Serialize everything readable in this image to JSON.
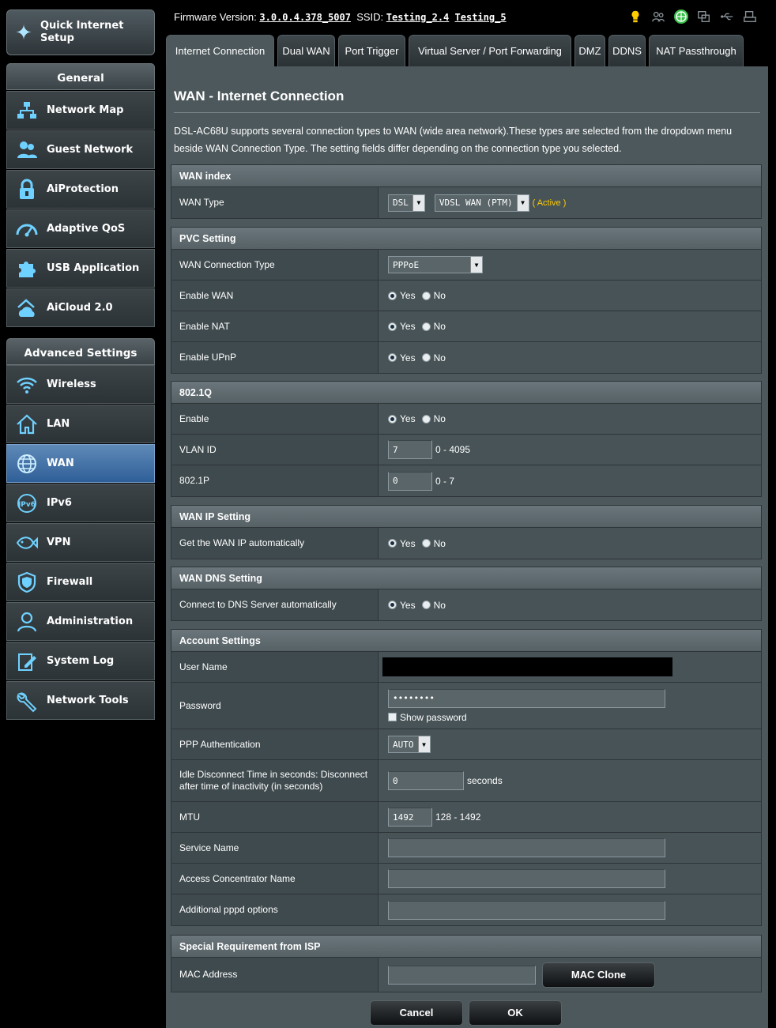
{
  "sidebar": {
    "qis_label": "Quick Internet Setup",
    "general_header": "General",
    "general_items": [
      {
        "label": "Network Map"
      },
      {
        "label": "Guest Network"
      },
      {
        "label": "AiProtection"
      },
      {
        "label": "Adaptive QoS"
      },
      {
        "label": "USB Application"
      },
      {
        "label": "AiCloud 2.0"
      }
    ],
    "advanced_header": "Advanced Settings",
    "advanced_items": [
      {
        "label": "Wireless"
      },
      {
        "label": "LAN"
      },
      {
        "label": "WAN"
      },
      {
        "label": "IPv6"
      },
      {
        "label": "VPN"
      },
      {
        "label": "Firewall"
      },
      {
        "label": "Administration"
      },
      {
        "label": "System Log"
      },
      {
        "label": "Network Tools"
      }
    ],
    "active_item": "WAN"
  },
  "topbar": {
    "firmware_label": "Firmware Version:",
    "firmware_value": "3.0.0.4.378_5007",
    "ssid_label": "SSID:",
    "ssid_1": "Testing_2.4",
    "ssid_2": "Testing_5"
  },
  "tabs": [
    {
      "label": "Internet Connection",
      "active": true
    },
    {
      "label": "Dual WAN"
    },
    {
      "label": "Port Trigger"
    },
    {
      "label": "Virtual Server / Port Forwarding"
    },
    {
      "label": "DMZ"
    },
    {
      "label": "DDNS"
    },
    {
      "label": "NAT Passthrough"
    }
  ],
  "page": {
    "title": "WAN - Internet Connection",
    "description": "DSL-AC68U supports several connection types to WAN (wide area network).These types are selected from the dropdown menu beside WAN Connection Type. The setting fields differ depending on the connection type you selected."
  },
  "radio": {
    "yes": "Yes",
    "no": "No"
  },
  "wan_index": {
    "header": "WAN index",
    "wan_type_label": "WAN Type",
    "wan_type_value": "DSL",
    "wan_mode_value": "VDSL WAN (PTM)",
    "active_text": "( Active )"
  },
  "pvc": {
    "header": "PVC Setting",
    "conn_type_label": "WAN Connection Type",
    "conn_type_value": "PPPoE",
    "enable_wan_label": "Enable WAN",
    "enable_nat_label": "Enable NAT",
    "enable_upnp_label": "Enable UPnP"
  },
  "dot1q": {
    "header": "802.1Q",
    "enable_label": "Enable",
    "vlan_label": "VLAN ID",
    "vlan_value": "7",
    "vlan_range": "0 - 4095",
    "p_label": "802.1P",
    "p_value": "0",
    "p_range": "0 - 7"
  },
  "wan_ip": {
    "header": "WAN IP Setting",
    "auto_label": "Get the WAN IP automatically"
  },
  "wan_dns": {
    "header": "WAN DNS Setting",
    "auto_label": "Connect to DNS Server automatically"
  },
  "account": {
    "header": "Account Settings",
    "username_label": "User Name",
    "password_label": "Password",
    "password_value": "••••••••",
    "show_password_label": "Show password",
    "ppp_auth_label": "PPP Authentication",
    "ppp_auth_value": "AUTO",
    "idle_label": "Idle Disconnect Time in seconds: Disconnect after time of inactivity (in seconds)",
    "idle_value": "0",
    "idle_unit": "seconds",
    "mtu_label": "MTU",
    "mtu_value": "1492",
    "mtu_range": "128 - 1492",
    "service_label": "Service Name",
    "ac_label": "Access Concentrator Name",
    "pppd_label": "Additional pppd options"
  },
  "isp": {
    "header": "Special Requirement from ISP",
    "mac_label": "MAC Address",
    "mac_clone_label": "MAC Clone"
  },
  "actions": {
    "cancel": "Cancel",
    "ok": "OK"
  },
  "colors": {
    "active_tab_bg": "#4d585c",
    "active_menu": "#2f5f98",
    "active_status": "#ffcc00"
  }
}
